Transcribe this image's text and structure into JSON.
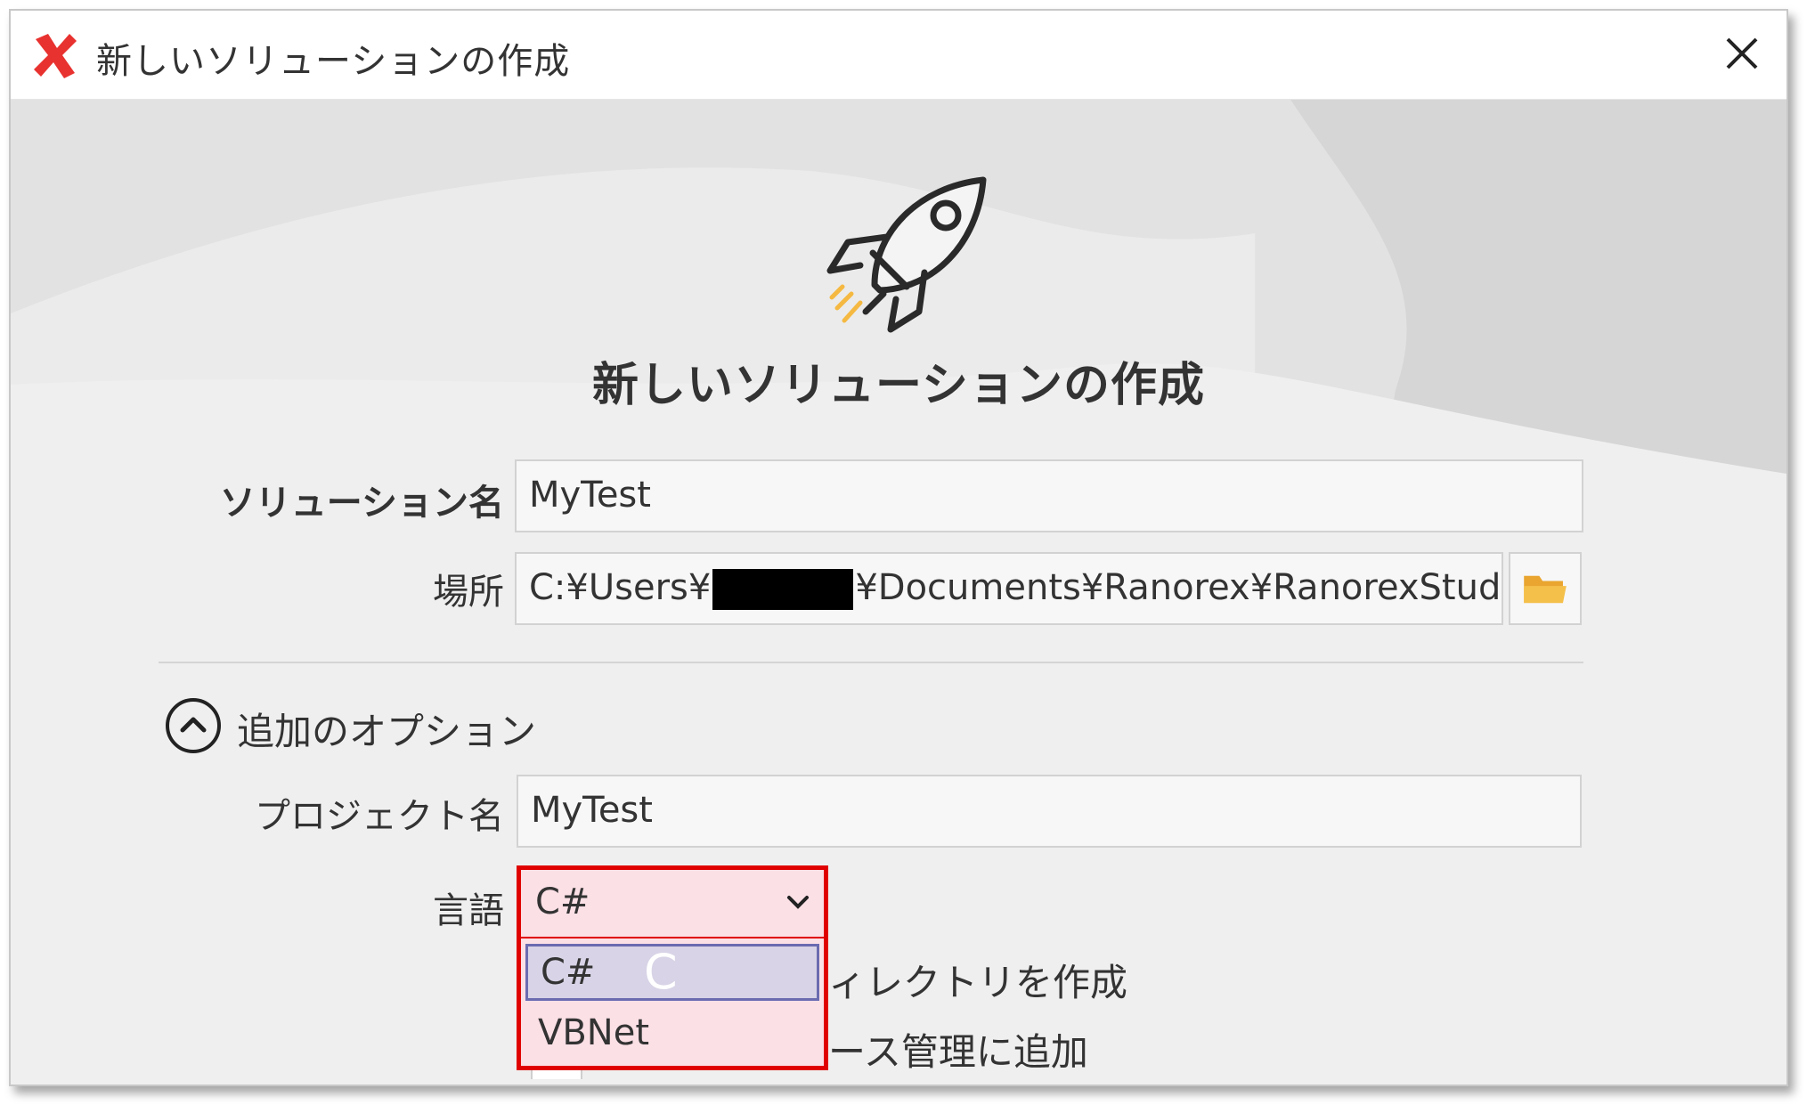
{
  "window": {
    "title": "新しいソリューションの作成",
    "app_icon": "ranorex-x-icon",
    "close_icon": "close-icon"
  },
  "header": {
    "title": "新しいソリューションの作成",
    "icon": "rocket-icon"
  },
  "form": {
    "solution_name_label": "ソリューション名",
    "solution_name_value": "MyTest",
    "location_label": "場所",
    "location_value_prefix": "C:¥Users¥",
    "location_value_suffix": "¥Documents¥Ranorex¥RanorexStudio Pr",
    "browse_icon": "folder-icon"
  },
  "options": {
    "toggle_label": "追加のオプション",
    "toggle_icon": "chevron-up-icon",
    "project_name_label": "プロジェクト名",
    "project_name_value": "MyTest",
    "language_label": "言語",
    "language_selected": "C#",
    "language_options": [
      "C#",
      "VBNet"
    ],
    "hover_letter": "C",
    "behind_text_1": "ィレクトリを作成",
    "behind_text_2": "ース管理に追加"
  },
  "colors": {
    "highlight_border": "#e00000",
    "dropdown_bg": "#fbe0e6",
    "selected_item_bg": "#d8d3e6",
    "folder": "#f5b942"
  }
}
